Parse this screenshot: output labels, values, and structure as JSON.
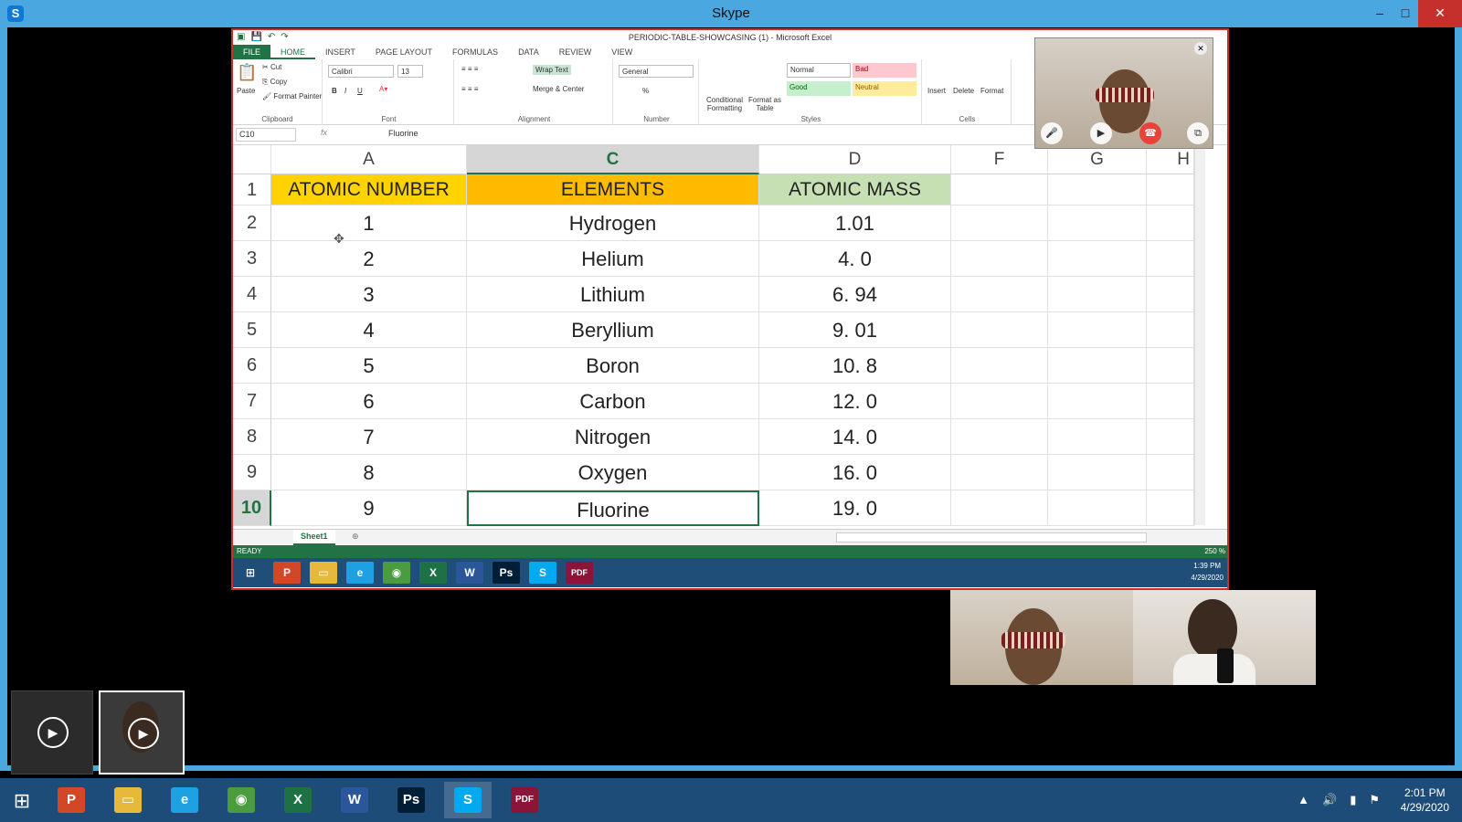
{
  "skype": {
    "title": "Skype",
    "logo_letter": "S",
    "controls": {
      "minimize": "–",
      "maximize": "□",
      "close": "✕"
    }
  },
  "excel": {
    "window_title": "PERIODIC-TABLE-SHOWCASING (1) - Microsoft Excel",
    "tabs": [
      "FILE",
      "HOME",
      "INSERT",
      "PAGE LAYOUT",
      "FORMULAS",
      "DATA",
      "REVIEW",
      "VIEW"
    ],
    "active_tab": "HOME",
    "ribbon": {
      "clipboard": {
        "label": "Clipboard",
        "paste": "Paste",
        "cut": "Cut",
        "copy": "Copy",
        "format_painter": "Format Painter"
      },
      "font": {
        "label": "Font",
        "name": "Calibri",
        "size": "13",
        "bold": "B",
        "italic": "I",
        "underline": "U"
      },
      "alignment": {
        "label": "Alignment",
        "wrap_text": "Wrap Text",
        "merge_center": "Merge & Center"
      },
      "number": {
        "label": "Number",
        "format": "General",
        "percent": "%"
      },
      "styles": {
        "label": "Styles",
        "conditional": "Conditional Formatting",
        "format_as_table": "Format as Table",
        "normal": "Normal",
        "bad": "Bad",
        "good": "Good",
        "neutral": "Neutral"
      },
      "cells": {
        "label": "Cells",
        "insert": "Insert",
        "delete": "Delete",
        "format": "Format"
      }
    },
    "formula_bar": {
      "name_box": "C10",
      "fx": "fx",
      "value": "Fluorine"
    },
    "columns": [
      {
        "id": "A",
        "selected": false
      },
      {
        "id": "C",
        "selected": true
      },
      {
        "id": "D",
        "selected": false
      },
      {
        "id": "F",
        "selected": false
      },
      {
        "id": "G",
        "selected": false
      },
      {
        "id": "H",
        "selected": false
      }
    ],
    "header_row": {
      "number": "1",
      "a": "ATOMIC NUMBER",
      "c": "ELEMENTS",
      "d": "ATOMIC MASS"
    },
    "rows": [
      {
        "row": "2",
        "atomic_number": "1",
        "element": "Hydrogen",
        "mass": "1.01"
      },
      {
        "row": "3",
        "atomic_number": "2",
        "element": "Helium",
        "mass": "4. 0"
      },
      {
        "row": "4",
        "atomic_number": "3",
        "element": "Lithium",
        "mass": "6. 94"
      },
      {
        "row": "5",
        "atomic_number": "4",
        "element": "Beryllium",
        "mass": "9. 01"
      },
      {
        "row": "6",
        "atomic_number": "5",
        "element": "Boron",
        "mass": "10. 8"
      },
      {
        "row": "7",
        "atomic_number": "6",
        "element": "Carbon",
        "mass": "12. 0"
      },
      {
        "row": "8",
        "atomic_number": "7",
        "element": "Nitrogen",
        "mass": "14. 0"
      },
      {
        "row": "9",
        "atomic_number": "8",
        "element": "Oxygen",
        "mass": "16. 0"
      },
      {
        "row": "10",
        "atomic_number": "9",
        "element": "Fluorine",
        "mass": "19. 0"
      }
    ],
    "active_row": "10",
    "sheet_tab": "Sheet1",
    "status": "READY",
    "zoom": "250 %",
    "inner_clock": {
      "time": "1:39 PM",
      "date": "4/29/2020"
    }
  },
  "taskbar": {
    "apps": [
      {
        "name": "powerpoint",
        "glyph": "P",
        "color": "#d24726"
      },
      {
        "name": "file-explorer",
        "glyph": "▭",
        "color": "#e8b83a"
      },
      {
        "name": "internet-explorer",
        "glyph": "e",
        "color": "#1ea1e3"
      },
      {
        "name": "chrome",
        "glyph": "◉",
        "color": "#4a9c3f"
      },
      {
        "name": "excel",
        "glyph": "X",
        "color": "#1e7145"
      },
      {
        "name": "word",
        "glyph": "W",
        "color": "#2b579a"
      },
      {
        "name": "photoshop",
        "glyph": "Ps",
        "color": "#001e36"
      },
      {
        "name": "skype",
        "glyph": "S",
        "color": "#00a9f0"
      },
      {
        "name": "pdf",
        "glyph": "PDF",
        "color": "#8a1538"
      }
    ],
    "active_app": "skype",
    "clock": {
      "time": "2:01 PM",
      "date": "4/29/2020"
    }
  }
}
